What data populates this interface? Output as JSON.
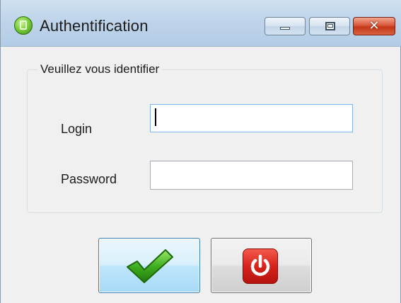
{
  "window": {
    "title": "Authentification",
    "controls": {
      "minimize": "minimize",
      "maximize": "maximize",
      "close": "close"
    }
  },
  "form": {
    "group_title": "Veuillez vous identifier",
    "login_label": "Login",
    "login_value": "",
    "password_label": "Password",
    "password_value": ""
  },
  "actions": {
    "ok_icon": "check-icon",
    "quit_icon": "power-icon"
  },
  "colors": {
    "check_green": "#3fae1f",
    "power_red": "#d8231b"
  }
}
